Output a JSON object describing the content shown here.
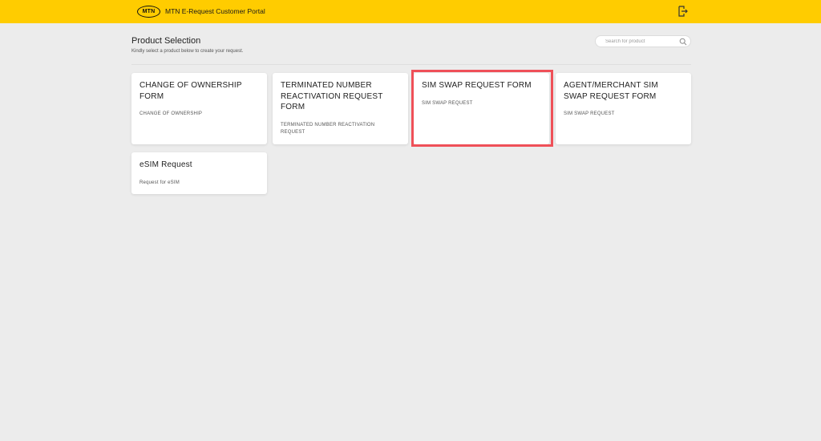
{
  "header": {
    "logo_text": "MTN",
    "app_title": "MTN E-Request Customer Portal",
    "logout_icon": "logout-door-icon",
    "background_color": "#ffcc00"
  },
  "page": {
    "title": "Product Selection",
    "subtitle": "Kindly select a product below to create your request."
  },
  "search": {
    "placeholder": "Search for product",
    "value": "",
    "icon": "search-icon"
  },
  "products": [
    {
      "title": "CHANGE OF OWNERSHIP FORM",
      "description": "CHANGE OF OWNERSHIP"
    },
    {
      "title": "TERMINATED NUMBER REACTIVATION REQUEST FORM",
      "description": "TERMINATED NUMBER REACTIVATION REQUEST"
    },
    {
      "title": "SIM SWAP REQUEST FORM",
      "description": "SIM SWAP REQUEST",
      "highlighted": true
    },
    {
      "title": "AGENT/MERCHANT SIM SWAP REQUEST FORM",
      "description": "SIM SWAP REQUEST"
    },
    {
      "title": "eSIM Request",
      "description": "Request for eSIM"
    }
  ],
  "colors": {
    "highlight_border": "#ef5058",
    "page_background": "#ececec"
  }
}
